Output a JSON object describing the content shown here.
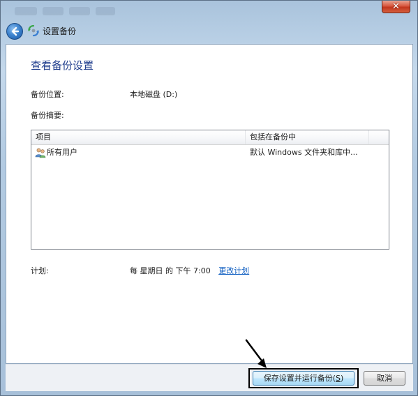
{
  "window": {
    "close_label": "✕",
    "back_icon": "back-arrow-icon",
    "header_icon": "backup-icon",
    "header_title": "设置备份"
  },
  "page": {
    "title": "查看备份设置",
    "location_label": "备份位置:",
    "location_value": "本地磁盘 (D:)",
    "summary_label": "备份摘要:",
    "schedule_label": "计划:",
    "schedule_value": "每 星期日 的 下午 7:00",
    "schedule_link": "更改计划"
  },
  "summary_table": {
    "columns": [
      "项目",
      "包括在备份中"
    ],
    "rows": [
      {
        "icon": "users-icon",
        "item": "所有用户",
        "included": "默认 Windows 文件夹和库中..."
      }
    ]
  },
  "footer": {
    "save_button_label": "保存设置并运行备份",
    "save_button_mnemonic": "S",
    "cancel_button_label": "取消"
  },
  "colors": {
    "title_blue": "#1e3c8c",
    "link_blue": "#0f5ec1",
    "annotation": "#000000"
  }
}
